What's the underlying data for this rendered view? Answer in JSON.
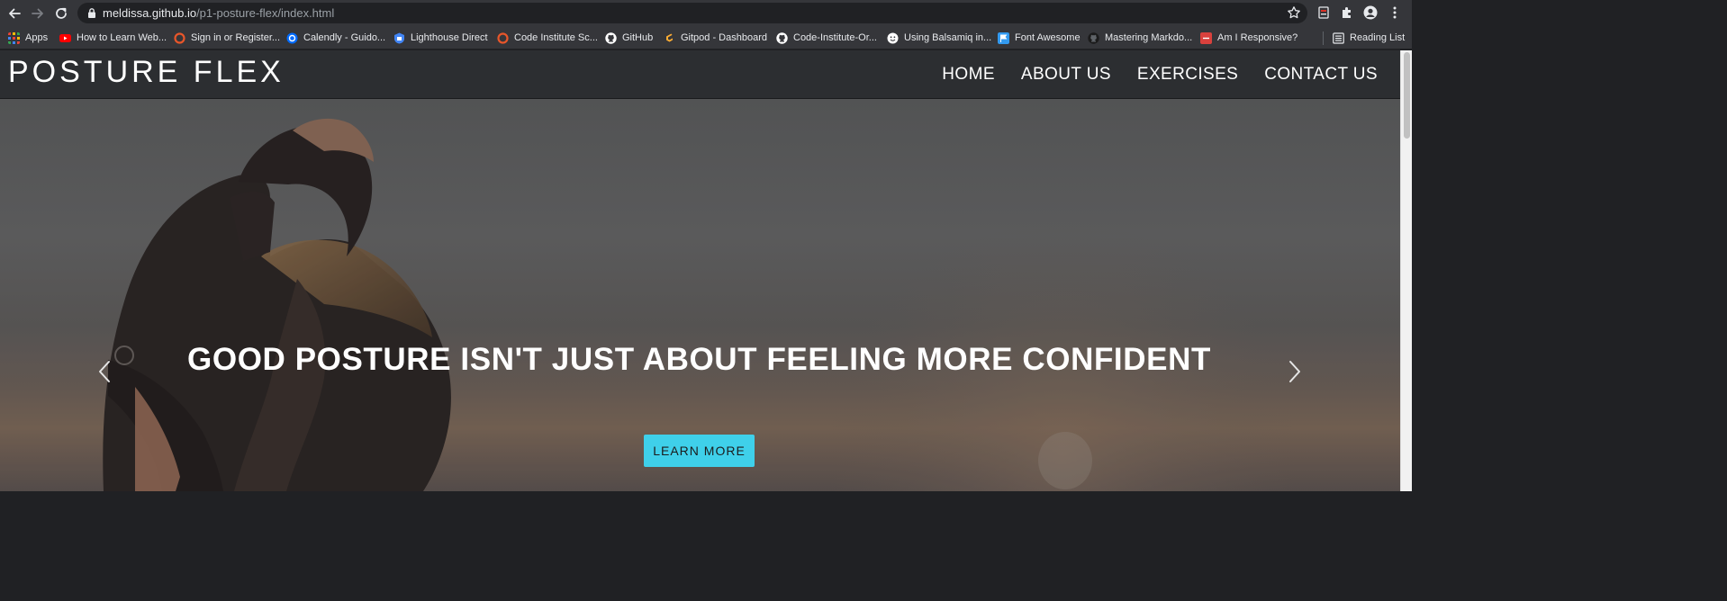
{
  "browser": {
    "url_host": "meldissa.github.io",
    "url_path": "/p1-posture-flex/index.html",
    "icons": [
      "back-arrow-icon",
      "forward-arrow-icon",
      "reload-icon",
      "lock-icon",
      "star-icon",
      "extension-icon",
      "puzzle-icon",
      "profile-icon",
      "menu-dots-icon"
    ]
  },
  "bookmarks": {
    "items": [
      {
        "label": "Apps",
        "icon": "apps-grid-icon",
        "color": "#ea4335"
      },
      {
        "label": "How to Learn Web...",
        "icon": "youtube-icon",
        "color": "#ff0000"
      },
      {
        "label": "Sign in or Register...",
        "icon": "code-institute-icon",
        "color": "#e8562a"
      },
      {
        "label": "Calendly - Guido...",
        "icon": "calendly-icon",
        "color": "#006bff"
      },
      {
        "label": "Lighthouse Direct",
        "icon": "lighthouse-icon",
        "color": "#4285f4"
      },
      {
        "label": "Code Institute Sc...",
        "icon": "code-institute-icon",
        "color": "#e8562a"
      },
      {
        "label": "GitHub",
        "icon": "github-icon",
        "color": "#ffffff"
      },
      {
        "label": "Gitpod - Dashboard",
        "icon": "gitpod-icon",
        "color": "#ffae33"
      },
      {
        "label": "Code-Institute-Or...",
        "icon": "github-icon",
        "color": "#ffffff"
      },
      {
        "label": "Using Balsamiq in...",
        "icon": "balsamiq-icon",
        "color": "#ffffff"
      },
      {
        "label": "Font Awesome",
        "icon": "font-awesome-icon",
        "color": "#339af0"
      },
      {
        "label": "Mastering Markdo...",
        "icon": "github-icon",
        "color": "#1b1b1b"
      },
      {
        "label": "Am I Responsive?",
        "icon": "am-i-responsive-icon",
        "color": "#d9413d"
      }
    ],
    "reading_list": "Reading List"
  },
  "site": {
    "brand": "POSTURE FLEX",
    "nav": [
      "HOME",
      "ABOUT US",
      "EXERCISES",
      "CONTACT US"
    ]
  },
  "hero": {
    "title": "GOOD POSTURE ISN'T JUST ABOUT FEELING MORE CONFIDENT",
    "cta": "LEARN MORE",
    "cta_color": "#3fd0ea"
  }
}
